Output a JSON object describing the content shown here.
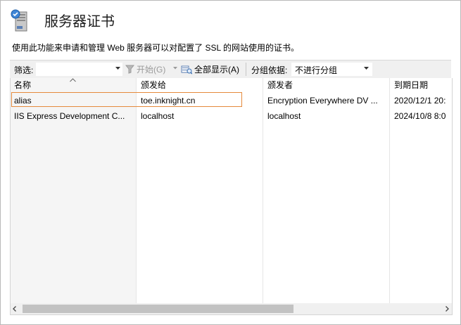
{
  "header": {
    "title": "服务器证书",
    "description": "使用此功能来申请和管理 Web 服务器可以对配置了 SSL 的网站使用的证书。",
    "icon": "server-certificates-icon"
  },
  "filter_bar": {
    "filter_label": "筛选:",
    "filter_value": "",
    "go_label": "开始(G)",
    "show_all_label": "全部显示(A)",
    "group_by_label": "分组依据:",
    "group_by_value": "不进行分组"
  },
  "table": {
    "columns": [
      "名称",
      "颁发给",
      "颁发者",
      "到期日期"
    ],
    "sorted_column": "名称",
    "rows": [
      {
        "name": "alias",
        "issued_to": "toe.inknight.cn",
        "issued_by": "Encryption Everywhere DV ...",
        "expires": "2020/12/1 20:"
      },
      {
        "name": "IIS Express Development C...",
        "issued_to": "localhost",
        "issued_by": "localhost",
        "expires": "2024/10/8 8:0"
      }
    ],
    "selected_row": 0
  },
  "colors": {
    "selection_border": "#e58a3c",
    "toolbar_bg": "#f0f0f0",
    "scroll_thumb": "#c2c2c2"
  }
}
